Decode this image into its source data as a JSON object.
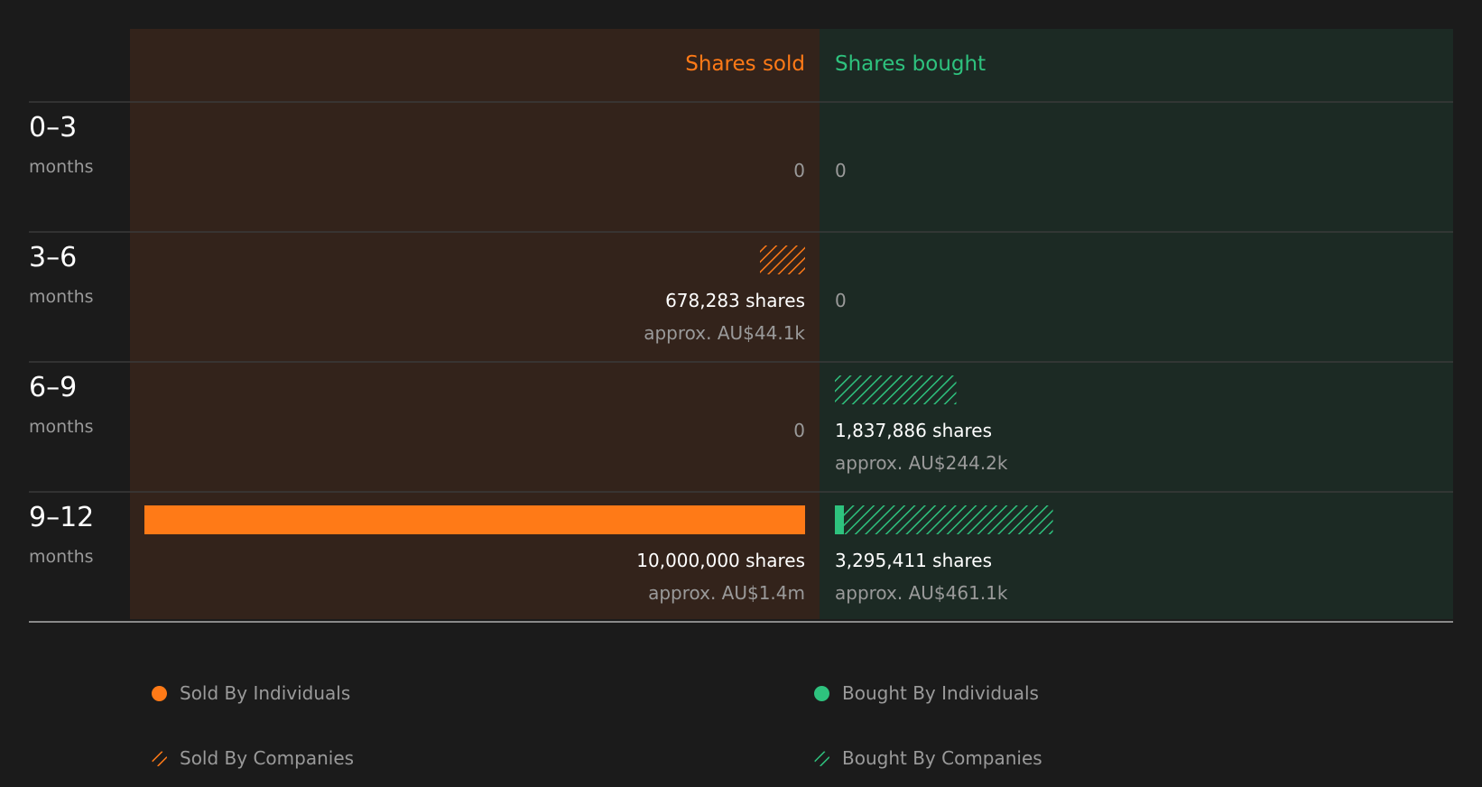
{
  "colors": {
    "background": "#1b1b1b",
    "sold_bg": "#33231b",
    "bought_bg": "#1c2a24",
    "sold": "#ff7a17",
    "bought": "#2ec27e",
    "divider": "#3a3a3a",
    "label_primary": "#ffffff",
    "label_muted": "#9a9a9a"
  },
  "header": {
    "sold": "Shares sold",
    "bought": "Shares bought"
  },
  "legend": {
    "items": [
      {
        "label": "Sold By Individuals",
        "style": "dot",
        "color": "sold"
      },
      {
        "label": "Bought By Individuals",
        "style": "dot",
        "color": "bought"
      },
      {
        "label": "Sold By Companies",
        "style": "hatch",
        "color": "sold"
      },
      {
        "label": "Bought By Companies",
        "style": "hatch",
        "color": "bought"
      }
    ]
  },
  "chart_data": {
    "type": "bar",
    "title": "",
    "max_shares": 10000000,
    "rows": [
      {
        "period": "0–3",
        "unit": "months",
        "sold": {
          "individuals": 0,
          "companies": 0,
          "label": "0",
          "value_label": ""
        },
        "bought": {
          "individuals": 0,
          "companies": 0,
          "label": "0",
          "value_label": ""
        }
      },
      {
        "period": "3–6",
        "unit": "months",
        "sold": {
          "individuals": 0,
          "companies": 678283,
          "label": "678,283 shares",
          "value_label": "approx. AU$44.1k"
        },
        "bought": {
          "individuals": 0,
          "companies": 0,
          "label": "0",
          "value_label": ""
        }
      },
      {
        "period": "6–9",
        "unit": "months",
        "sold": {
          "individuals": 0,
          "companies": 0,
          "label": "0",
          "value_label": ""
        },
        "bought": {
          "individuals": 0,
          "companies": 1837886,
          "label": "1,837,886 shares",
          "value_label": "approx. AU$244.2k"
        }
      },
      {
        "period": "9–12",
        "unit": "months",
        "sold": {
          "individuals": 10000000,
          "companies": 0,
          "label": "10,000,000 shares",
          "value_label": "approx. AU$1.4m"
        },
        "bought": {
          "individuals": 131000,
          "companies": 3164411,
          "label": "3,295,411 shares",
          "value_label": "approx. AU$461.1k"
        }
      }
    ]
  }
}
